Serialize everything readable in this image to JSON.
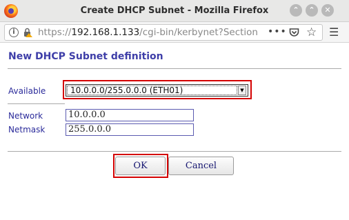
{
  "window": {
    "title": "Create DHCP Subnet - Mozilla Firefox",
    "controls": [
      "minimize",
      "maximize",
      "close"
    ]
  },
  "urlbar": {
    "scheme": "https://",
    "host": "192.168.1.133",
    "path": "/cgi-bin/kerbynet?Section=D",
    "more_label": "•••"
  },
  "page": {
    "heading": "New DHCP Subnet definition",
    "available_label": "Available",
    "available_value": "10.0.0.0/255.0.0.0 (ETH01)",
    "network_label": "Network",
    "network_value": "10.0.0.0",
    "netmask_label": "Netmask",
    "netmask_value": "255.0.0.0",
    "ok_label": "OK",
    "cancel_label": "Cancel"
  },
  "colors": {
    "heading": "#3e3ea8",
    "highlight": "#d40000"
  }
}
